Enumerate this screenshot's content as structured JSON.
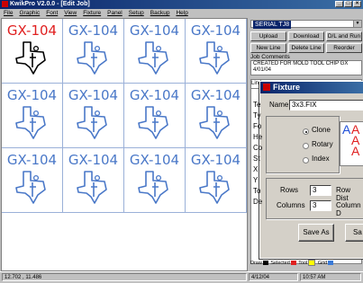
{
  "window": {
    "title": "KwikPro  V2.0.0 - [Edit Job]"
  },
  "menu": [
    "File",
    "Graphic",
    "Font",
    "View",
    "Fixture",
    "Panel",
    "Setup",
    "Backup",
    "Help"
  ],
  "grid": {
    "cell_label": "GX-104",
    "rows": 3,
    "cols": 4,
    "selected_cell": 0
  },
  "right_panel": {
    "serial_combo": "SERIAL TJ8",
    "buttons": {
      "upload": "Upload",
      "download": "Download",
      "dl_run": "D/L and Run",
      "new_line": "New Line",
      "delete_line": "Delete Line",
      "reorder": "Reorder"
    },
    "job_comments_label": "Job Comments",
    "job_comments": "CREATED FOR MOLD TOOL CHIP GX",
    "job_comments_date": "4/01/04",
    "list_tab": "Line",
    "list_items": [
      "Te",
      "Ty",
      "Fo",
      "He",
      "Co",
      "St",
      "X",
      "Y",
      "To",
      "De"
    ],
    "legend": {
      "draw": "Draw",
      "selected": "Selected",
      "tool": "Tool",
      "grid": "Grid"
    }
  },
  "fixture_dialog": {
    "title": "Fixture",
    "name_label": "Name",
    "name_value": "3x3.FIX",
    "radio_clone": "Clone",
    "radio_rotary": "Rotary",
    "radio_index": "Index",
    "preview_letter": "A",
    "rows_label": "Rows",
    "rows_value": "3",
    "row_dist_label": "Row Dist",
    "columns_label": "Columns",
    "columns_value": "3",
    "column_dist_label": "Column D",
    "save_as": "Save As",
    "save": "Sa"
  },
  "status": {
    "coords": "12.702 , 11.486",
    "date": "4/12/04",
    "time": "10:57 AM"
  },
  "colors": {
    "title_start": "#0a246a",
    "grid_blue": "#4a78c8",
    "selected_red": "#e02020",
    "legend_draw": "#000000",
    "legend_selected": "#e02020",
    "legend_tool": "#ffff00",
    "legend_grid": "#3a7ad8"
  }
}
